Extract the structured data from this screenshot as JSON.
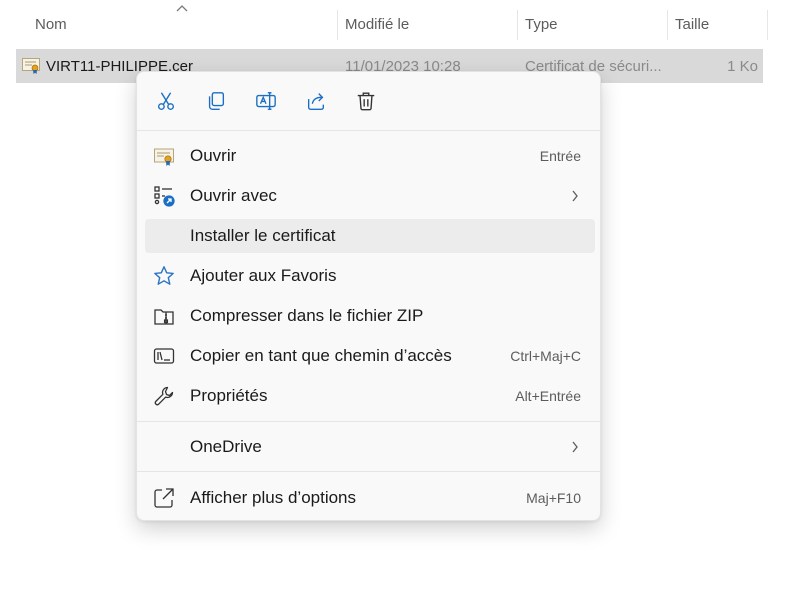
{
  "columns": {
    "name": "Nom",
    "modified": "Modifié le",
    "type": "Type",
    "size": "Taille"
  },
  "file": {
    "name": "VIRT11-PHILIPPE.cer",
    "modified": "11/01/2023 10:28",
    "type": "Certificat de sécuri...",
    "size": "1 Ko"
  },
  "quick_actions": [
    {
      "icon": "cut-icon"
    },
    {
      "icon": "copy-icon"
    },
    {
      "icon": "rename-icon"
    },
    {
      "icon": "share-icon"
    },
    {
      "icon": "delete-icon"
    }
  ],
  "menu": {
    "open": {
      "label": "Ouvrir",
      "shortcut": "Entrée",
      "icon": "certificate-icon"
    },
    "open_with": {
      "label": "Ouvrir avec",
      "icon": "open-with-icon"
    },
    "install_cert": {
      "label": "Installer le certificat"
    },
    "favorites": {
      "label": "Ajouter aux Favoris",
      "icon": "star-icon"
    },
    "zip": {
      "label": "Compresser dans le fichier ZIP",
      "icon": "zip-folder-icon"
    },
    "copy_path": {
      "label": "Copier en tant que chemin d’accès",
      "shortcut": "Ctrl+Maj+C",
      "icon": "copy-path-icon"
    },
    "properties": {
      "label": "Propriétés",
      "shortcut": "Alt+Entrée",
      "icon": "wrench-icon"
    },
    "onedrive": {
      "label": "OneDrive"
    },
    "more_options": {
      "label": "Afficher plus d’options",
      "shortcut": "Maj+F10",
      "icon": "more-options-icon"
    }
  },
  "colors": {
    "accent": "#1a6fc4",
    "selection": "#d9d9d9",
    "menu_bg": "#f9f9f9",
    "hover": "#ececec",
    "star": "#2a73c5"
  }
}
